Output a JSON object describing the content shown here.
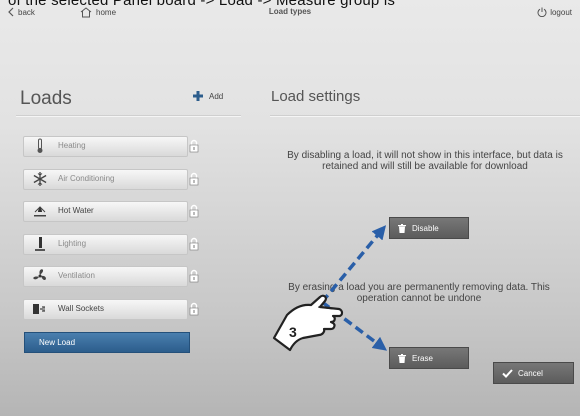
{
  "caption_fragment": "of the selected Panel board -> Load -> Measure group is",
  "topbar": {
    "back_label": "back",
    "home_label": "home",
    "title": "Load types",
    "logout_label": "logout"
  },
  "loads_panel": {
    "title": "Loads",
    "add_label": "Add",
    "items": [
      {
        "label": "Heating",
        "icon": "thermometer-icon"
      },
      {
        "label": "Air Conditioning",
        "icon": "snowflake-icon"
      },
      {
        "label": "Hot Water",
        "icon": "hot-water-icon"
      },
      {
        "label": "Lighting",
        "icon": "lamp-icon"
      },
      {
        "label": "Ventilation",
        "icon": "fan-icon"
      },
      {
        "label": "Wall Sockets",
        "icon": "plug-icon"
      }
    ],
    "new_load_label": "New Load"
  },
  "settings": {
    "title": "Load settings",
    "disable_text": "By disabling a load, it will not show in this interface, but data is retained and will still be available for download",
    "disable_label": "Disable",
    "erase_text": "By erasing a load you are permanently removing data. This operation cannot be undone",
    "erase_label": "Erase",
    "cancel_label": "Cancel"
  },
  "annotation": {
    "step_number": "3"
  },
  "colors": {
    "accent": "#2c5d8c",
    "annotation_arrow": "#2a5fa8",
    "button_dark": "#666666"
  }
}
